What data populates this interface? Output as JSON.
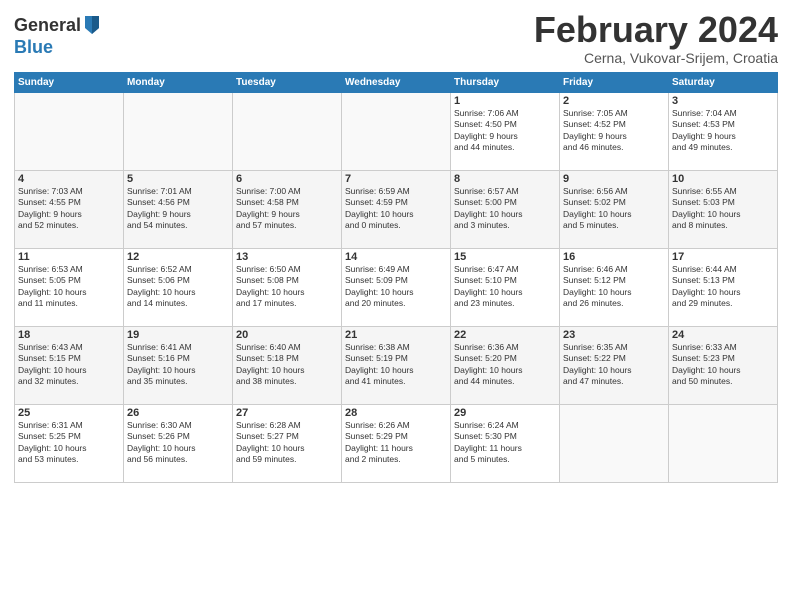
{
  "logo": {
    "general": "General",
    "blue": "Blue"
  },
  "header": {
    "title": "February 2024",
    "subtitle": "Cerna, Vukovar-Srijem, Croatia"
  },
  "weekdays": [
    "Sunday",
    "Monday",
    "Tuesday",
    "Wednesday",
    "Thursday",
    "Friday",
    "Saturday"
  ],
  "weeks": [
    [
      {
        "day": "",
        "details": ""
      },
      {
        "day": "",
        "details": ""
      },
      {
        "day": "",
        "details": ""
      },
      {
        "day": "",
        "details": ""
      },
      {
        "day": "1",
        "details": "Sunrise: 7:06 AM\nSunset: 4:50 PM\nDaylight: 9 hours\nand 44 minutes."
      },
      {
        "day": "2",
        "details": "Sunrise: 7:05 AM\nSunset: 4:52 PM\nDaylight: 9 hours\nand 46 minutes."
      },
      {
        "day": "3",
        "details": "Sunrise: 7:04 AM\nSunset: 4:53 PM\nDaylight: 9 hours\nand 49 minutes."
      }
    ],
    [
      {
        "day": "4",
        "details": "Sunrise: 7:03 AM\nSunset: 4:55 PM\nDaylight: 9 hours\nand 52 minutes."
      },
      {
        "day": "5",
        "details": "Sunrise: 7:01 AM\nSunset: 4:56 PM\nDaylight: 9 hours\nand 54 minutes."
      },
      {
        "day": "6",
        "details": "Sunrise: 7:00 AM\nSunset: 4:58 PM\nDaylight: 9 hours\nand 57 minutes."
      },
      {
        "day": "7",
        "details": "Sunrise: 6:59 AM\nSunset: 4:59 PM\nDaylight: 10 hours\nand 0 minutes."
      },
      {
        "day": "8",
        "details": "Sunrise: 6:57 AM\nSunset: 5:00 PM\nDaylight: 10 hours\nand 3 minutes."
      },
      {
        "day": "9",
        "details": "Sunrise: 6:56 AM\nSunset: 5:02 PM\nDaylight: 10 hours\nand 5 minutes."
      },
      {
        "day": "10",
        "details": "Sunrise: 6:55 AM\nSunset: 5:03 PM\nDaylight: 10 hours\nand 8 minutes."
      }
    ],
    [
      {
        "day": "11",
        "details": "Sunrise: 6:53 AM\nSunset: 5:05 PM\nDaylight: 10 hours\nand 11 minutes."
      },
      {
        "day": "12",
        "details": "Sunrise: 6:52 AM\nSunset: 5:06 PM\nDaylight: 10 hours\nand 14 minutes."
      },
      {
        "day": "13",
        "details": "Sunrise: 6:50 AM\nSunset: 5:08 PM\nDaylight: 10 hours\nand 17 minutes."
      },
      {
        "day": "14",
        "details": "Sunrise: 6:49 AM\nSunset: 5:09 PM\nDaylight: 10 hours\nand 20 minutes."
      },
      {
        "day": "15",
        "details": "Sunrise: 6:47 AM\nSunset: 5:10 PM\nDaylight: 10 hours\nand 23 minutes."
      },
      {
        "day": "16",
        "details": "Sunrise: 6:46 AM\nSunset: 5:12 PM\nDaylight: 10 hours\nand 26 minutes."
      },
      {
        "day": "17",
        "details": "Sunrise: 6:44 AM\nSunset: 5:13 PM\nDaylight: 10 hours\nand 29 minutes."
      }
    ],
    [
      {
        "day": "18",
        "details": "Sunrise: 6:43 AM\nSunset: 5:15 PM\nDaylight: 10 hours\nand 32 minutes."
      },
      {
        "day": "19",
        "details": "Sunrise: 6:41 AM\nSunset: 5:16 PM\nDaylight: 10 hours\nand 35 minutes."
      },
      {
        "day": "20",
        "details": "Sunrise: 6:40 AM\nSunset: 5:18 PM\nDaylight: 10 hours\nand 38 minutes."
      },
      {
        "day": "21",
        "details": "Sunrise: 6:38 AM\nSunset: 5:19 PM\nDaylight: 10 hours\nand 41 minutes."
      },
      {
        "day": "22",
        "details": "Sunrise: 6:36 AM\nSunset: 5:20 PM\nDaylight: 10 hours\nand 44 minutes."
      },
      {
        "day": "23",
        "details": "Sunrise: 6:35 AM\nSunset: 5:22 PM\nDaylight: 10 hours\nand 47 minutes."
      },
      {
        "day": "24",
        "details": "Sunrise: 6:33 AM\nSunset: 5:23 PM\nDaylight: 10 hours\nand 50 minutes."
      }
    ],
    [
      {
        "day": "25",
        "details": "Sunrise: 6:31 AM\nSunset: 5:25 PM\nDaylight: 10 hours\nand 53 minutes."
      },
      {
        "day": "26",
        "details": "Sunrise: 6:30 AM\nSunset: 5:26 PM\nDaylight: 10 hours\nand 56 minutes."
      },
      {
        "day": "27",
        "details": "Sunrise: 6:28 AM\nSunset: 5:27 PM\nDaylight: 10 hours\nand 59 minutes."
      },
      {
        "day": "28",
        "details": "Sunrise: 6:26 AM\nSunset: 5:29 PM\nDaylight: 11 hours\nand 2 minutes."
      },
      {
        "day": "29",
        "details": "Sunrise: 6:24 AM\nSunset: 5:30 PM\nDaylight: 11 hours\nand 5 minutes."
      },
      {
        "day": "",
        "details": ""
      },
      {
        "day": "",
        "details": ""
      }
    ]
  ]
}
